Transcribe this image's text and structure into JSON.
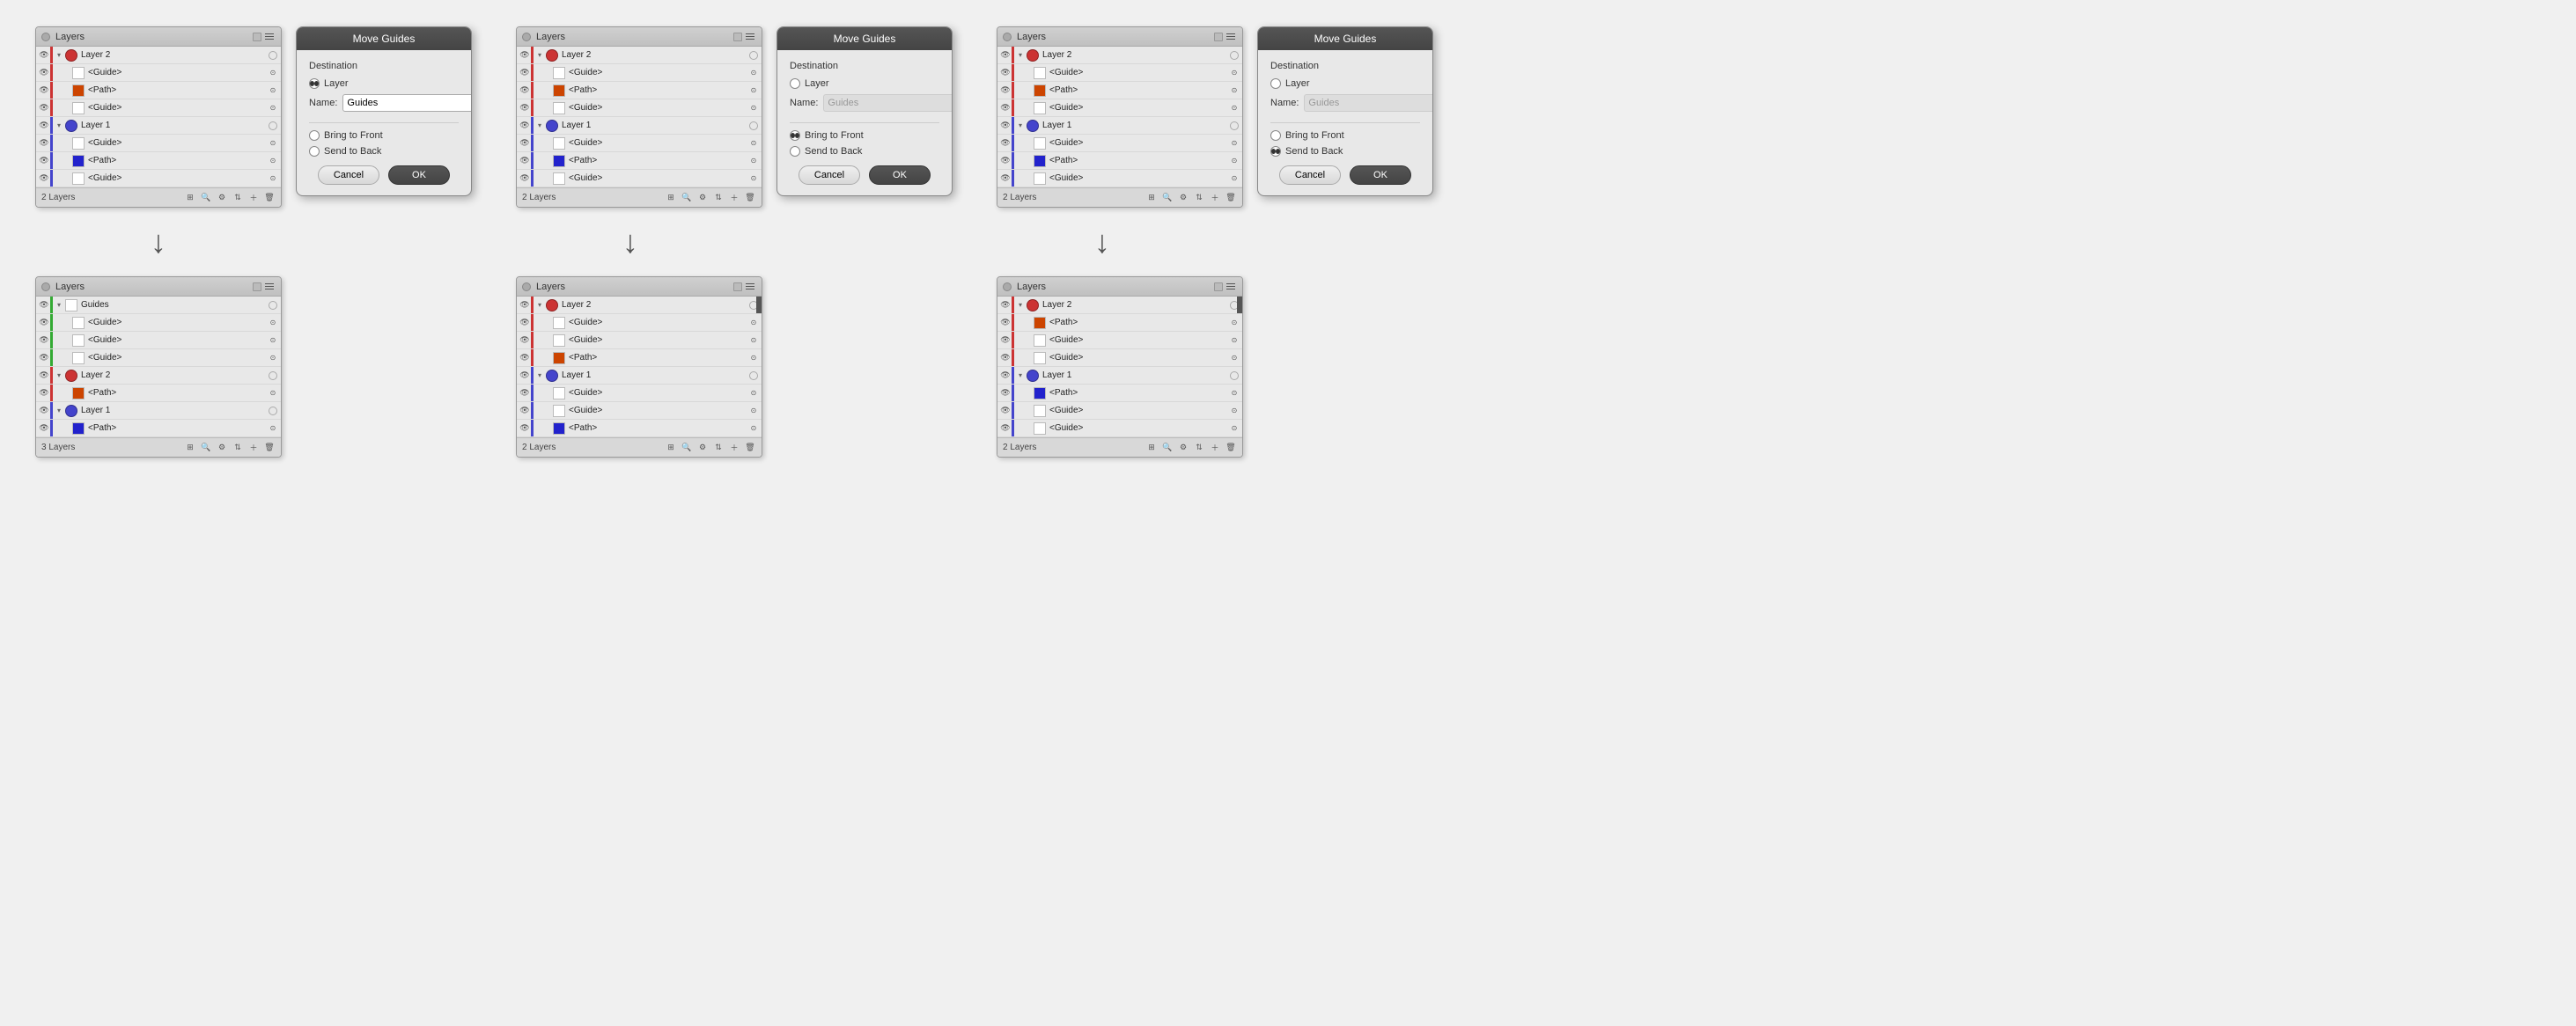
{
  "panels": {
    "row1": [
      {
        "id": "panel1",
        "title": "Layers",
        "count": "2 Layers",
        "layers": [
          {
            "level": 1,
            "bar": "red",
            "collapsed": true,
            "thumb": "red-dot",
            "name": "Layer 2",
            "hasCircle": true
          },
          {
            "level": 2,
            "bar": "red",
            "collapsed": false,
            "thumb": "white",
            "name": "<Guide>",
            "hasLock": true
          },
          {
            "level": 2,
            "bar": "red",
            "collapsed": false,
            "thumb": "red-orange",
            "name": "<Path>",
            "hasLock": true
          },
          {
            "level": 2,
            "bar": "red",
            "collapsed": false,
            "thumb": "white",
            "name": "<Guide>",
            "hasLock": true
          },
          {
            "level": 1,
            "bar": "blue",
            "collapsed": true,
            "thumb": "blue-dot",
            "name": "Layer 1",
            "hasCircle": true
          },
          {
            "level": 2,
            "bar": "blue",
            "collapsed": false,
            "thumb": "white",
            "name": "<Guide>",
            "hasLock": true
          },
          {
            "level": 2,
            "bar": "blue",
            "collapsed": false,
            "thumb": "blue-dot",
            "name": "<Path>",
            "hasLock": true
          },
          {
            "level": 2,
            "bar": "blue",
            "collapsed": false,
            "thumb": "white",
            "name": "<Guide>",
            "hasLock": true
          }
        ]
      },
      {
        "id": "dialog1",
        "title": "Move Guides",
        "destination": "Destination",
        "layerSelected": true,
        "nameLabel": "Name:",
        "nameValue": "Guides",
        "nameDisabled": false,
        "options": [
          "Bring to Front",
          "Send to Back"
        ],
        "selectedOption": null,
        "buttons": [
          "Cancel",
          "OK"
        ]
      },
      {
        "id": "panel2",
        "title": "Layers",
        "count": "2 Layers",
        "layers": [
          {
            "level": 1,
            "bar": "red",
            "collapsed": true,
            "thumb": "red-dot",
            "name": "Layer 2",
            "hasCircle": true
          },
          {
            "level": 2,
            "bar": "red",
            "collapsed": false,
            "thumb": "white",
            "name": "<Guide>",
            "hasLock": true
          },
          {
            "level": 2,
            "bar": "red",
            "collapsed": false,
            "thumb": "red-orange",
            "name": "<Path>",
            "hasLock": true
          },
          {
            "level": 2,
            "bar": "red",
            "collapsed": false,
            "thumb": "white",
            "name": "<Guide>",
            "hasLock": true
          },
          {
            "level": 1,
            "bar": "blue",
            "collapsed": true,
            "thumb": "blue-dot",
            "name": "Layer 1",
            "hasCircle": true
          },
          {
            "level": 2,
            "bar": "blue",
            "collapsed": false,
            "thumb": "white",
            "name": "<Guide>",
            "hasLock": true
          },
          {
            "level": 2,
            "bar": "blue",
            "collapsed": false,
            "thumb": "blue-dot",
            "name": "<Path>",
            "hasLock": true
          },
          {
            "level": 2,
            "bar": "blue",
            "collapsed": false,
            "thumb": "white",
            "name": "<Guide>",
            "hasLock": true
          }
        ]
      },
      {
        "id": "dialog2",
        "title": "Move Guides",
        "destination": "Destination",
        "layerSelected": false,
        "nameLabel": "Name:",
        "nameValue": "Guides",
        "nameDisabled": true,
        "options": [
          "Bring to Front",
          "Send to Back"
        ],
        "selectedOption": "Bring to Front",
        "buttons": [
          "Cancel",
          "OK"
        ]
      },
      {
        "id": "panel3",
        "title": "Layers",
        "count": "2 Layers",
        "layers": [
          {
            "level": 1,
            "bar": "red",
            "collapsed": true,
            "thumb": "red-dot",
            "name": "Layer 2",
            "hasCircle": true
          },
          {
            "level": 2,
            "bar": "red",
            "collapsed": false,
            "thumb": "white",
            "name": "<Guide>",
            "hasLock": true
          },
          {
            "level": 2,
            "bar": "red",
            "collapsed": false,
            "thumb": "red-orange",
            "name": "<Path>",
            "hasLock": true
          },
          {
            "level": 2,
            "bar": "red",
            "collapsed": false,
            "thumb": "white",
            "name": "<Guide>",
            "hasLock": true
          },
          {
            "level": 1,
            "bar": "blue",
            "collapsed": true,
            "thumb": "blue-dot",
            "name": "Layer 1",
            "hasCircle": true
          },
          {
            "level": 2,
            "bar": "blue",
            "collapsed": false,
            "thumb": "white",
            "name": "<Guide>",
            "hasLock": true
          },
          {
            "level": 2,
            "bar": "blue",
            "collapsed": false,
            "thumb": "blue-dot",
            "name": "<Path>",
            "hasLock": true
          },
          {
            "level": 2,
            "bar": "blue",
            "collapsed": false,
            "thumb": "white",
            "name": "<Guide>",
            "hasLock": true
          }
        ]
      },
      {
        "id": "dialog3",
        "title": "Move Guides",
        "destination": "Destination",
        "layerSelected": false,
        "nameLabel": "Name:",
        "nameValue": "Guides",
        "nameDisabled": true,
        "options": [
          "Bring to Front",
          "Send to Back"
        ],
        "selectedOption": "Send to Back",
        "buttons": [
          "Cancel",
          "OK"
        ]
      }
    ],
    "row2": [
      {
        "id": "panel4",
        "title": "Layers",
        "count": "3 Layers",
        "layers": [
          {
            "level": 1,
            "bar": "green",
            "collapsed": true,
            "thumb": "white-plain",
            "name": "Guides",
            "hasCircle": true
          },
          {
            "level": 2,
            "bar": "green",
            "collapsed": false,
            "thumb": "white",
            "name": "<Guide>",
            "hasLock": true
          },
          {
            "level": 2,
            "bar": "green",
            "collapsed": false,
            "thumb": "white",
            "name": "<Guide>",
            "hasLock": true
          },
          {
            "level": 2,
            "bar": "green",
            "collapsed": false,
            "thumb": "white",
            "name": "<Guide>",
            "hasLock": true
          },
          {
            "level": 1,
            "bar": "red",
            "collapsed": true,
            "thumb": "red-dot",
            "name": "Layer 2",
            "hasCircle": true
          },
          {
            "level": 2,
            "bar": "red",
            "collapsed": false,
            "thumb": "red-orange",
            "name": "<Path>",
            "hasLock": true
          },
          {
            "level": 1,
            "bar": "blue",
            "collapsed": true,
            "thumb": "blue-dot",
            "name": "Layer 1",
            "hasCircle": true
          },
          {
            "level": 2,
            "bar": "blue",
            "collapsed": false,
            "thumb": "blue-dot",
            "name": "<Path>",
            "hasLock": true
          }
        ]
      },
      {
        "id": "panel5",
        "title": "Layers",
        "count": "2 Layers",
        "layers": [
          {
            "level": 1,
            "bar": "red",
            "collapsed": true,
            "thumb": "red-dot",
            "name": "Layer 2",
            "hasCircle": true,
            "markRight": true
          },
          {
            "level": 2,
            "bar": "red",
            "collapsed": false,
            "thumb": "white",
            "name": "<Guide>",
            "hasLock": true
          },
          {
            "level": 2,
            "bar": "red",
            "collapsed": false,
            "thumb": "white",
            "name": "<Guide>",
            "hasLock": true
          },
          {
            "level": 2,
            "bar": "red",
            "collapsed": false,
            "thumb": "red-orange",
            "name": "<Path>",
            "hasLock": true
          },
          {
            "level": 1,
            "bar": "blue",
            "collapsed": true,
            "thumb": "blue-dot",
            "name": "Layer 1",
            "hasCircle": true
          },
          {
            "level": 2,
            "bar": "blue",
            "collapsed": false,
            "thumb": "white",
            "name": "<Guide>",
            "hasLock": true
          },
          {
            "level": 2,
            "bar": "blue",
            "collapsed": false,
            "thumb": "white",
            "name": "<Guide>",
            "hasLock": true
          },
          {
            "level": 2,
            "bar": "blue",
            "collapsed": false,
            "thumb": "blue-dot",
            "name": "<Path>",
            "hasLock": true
          }
        ]
      },
      {
        "id": "panel6",
        "title": "Layers",
        "count": "2 Layers",
        "layers": [
          {
            "level": 1,
            "bar": "red",
            "collapsed": true,
            "thumb": "red-dot",
            "name": "Layer 2",
            "hasCircle": true,
            "markRight": true
          },
          {
            "level": 2,
            "bar": "red",
            "collapsed": false,
            "thumb": "red-orange",
            "name": "<Path>",
            "hasLock": true
          },
          {
            "level": 2,
            "bar": "red",
            "collapsed": false,
            "thumb": "white",
            "name": "<Guide>",
            "hasLock": true
          },
          {
            "level": 2,
            "bar": "red",
            "collapsed": false,
            "thumb": "white",
            "name": "<Guide>",
            "hasLock": true
          },
          {
            "level": 1,
            "bar": "blue",
            "collapsed": true,
            "thumb": "blue-dot",
            "name": "Layer 1",
            "hasCircle": true
          },
          {
            "level": 2,
            "bar": "blue",
            "collapsed": false,
            "thumb": "blue-dot",
            "name": "<Path>",
            "hasLock": true
          },
          {
            "level": 2,
            "bar": "blue",
            "collapsed": false,
            "thumb": "white",
            "name": "<Guide>",
            "hasLock": true
          },
          {
            "level": 2,
            "bar": "blue",
            "collapsed": false,
            "thumb": "white",
            "name": "<Guide>",
            "hasLock": true
          }
        ]
      }
    ]
  },
  "arrows": {
    "down": "↓"
  }
}
